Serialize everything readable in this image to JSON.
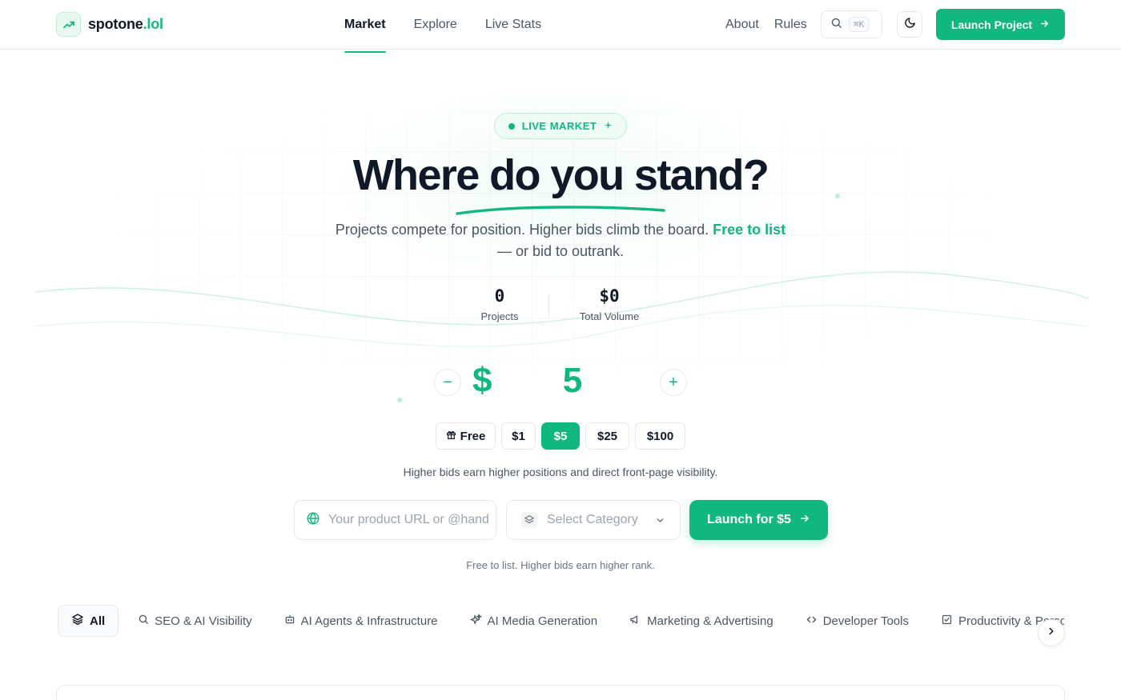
{
  "brand": {
    "name": "spotone",
    "tld": ".lol"
  },
  "nav": {
    "items": [
      {
        "label": "Market",
        "active": true
      },
      {
        "label": "Explore",
        "active": false
      },
      {
        "label": "Live Stats",
        "active": false
      }
    ],
    "about": "About",
    "rules": "Rules",
    "search_shortcut": "⌘K",
    "launch_label": "Launch Project"
  },
  "hero": {
    "badge": "LIVE MARKET",
    "title": "Where do you stand?",
    "subtitle_main": "Projects compete for position. Higher bids climb the board. ",
    "subtitle_highlight": "Free to list",
    "subtitle_tail": " — or bid to outrank."
  },
  "stats": {
    "projects_value": "0",
    "projects_label": "Projects",
    "volume_value": "$0",
    "volume_label": "Total Volume"
  },
  "bid": {
    "currency": "$",
    "amount": "5",
    "minus": "−",
    "plus": "+",
    "presets": [
      {
        "label": "Free",
        "icon": "gift-icon",
        "active": false
      },
      {
        "label": "$1",
        "active": false
      },
      {
        "label": "$5",
        "active": true
      },
      {
        "label": "$25",
        "active": false
      },
      {
        "label": "$100",
        "active": false
      }
    ],
    "hint": "Higher bids earn higher positions and direct front-page visibility."
  },
  "form": {
    "url_placeholder": "Your product URL or @handle",
    "url_value": "",
    "category_placeholder": "Select Category",
    "submit_label": "Launch for $5",
    "fine_print": "Free to list. Higher bids earn higher rank."
  },
  "categories": [
    {
      "label": "All",
      "icon": "layers-icon",
      "active": true
    },
    {
      "label": "SEO & AI Visibility",
      "icon": "search-icon",
      "active": false
    },
    {
      "label": "AI Agents & Infrastructure",
      "icon": "bot-icon",
      "active": false
    },
    {
      "label": "AI Media Generation",
      "icon": "sparkles-icon",
      "active": false
    },
    {
      "label": "Marketing & Advertising",
      "icon": "megaphone-icon",
      "active": false
    },
    {
      "label": "Developer Tools",
      "icon": "code-icon",
      "active": false
    },
    {
      "label": "Productivity & Personal",
      "icon": "check-square-icon",
      "active": false
    }
  ],
  "colors": {
    "accent": "#10b77f",
    "accent_soft": "#effbf5",
    "text": "#111827",
    "muted": "#4b5563",
    "border": "#e5e7eb"
  }
}
